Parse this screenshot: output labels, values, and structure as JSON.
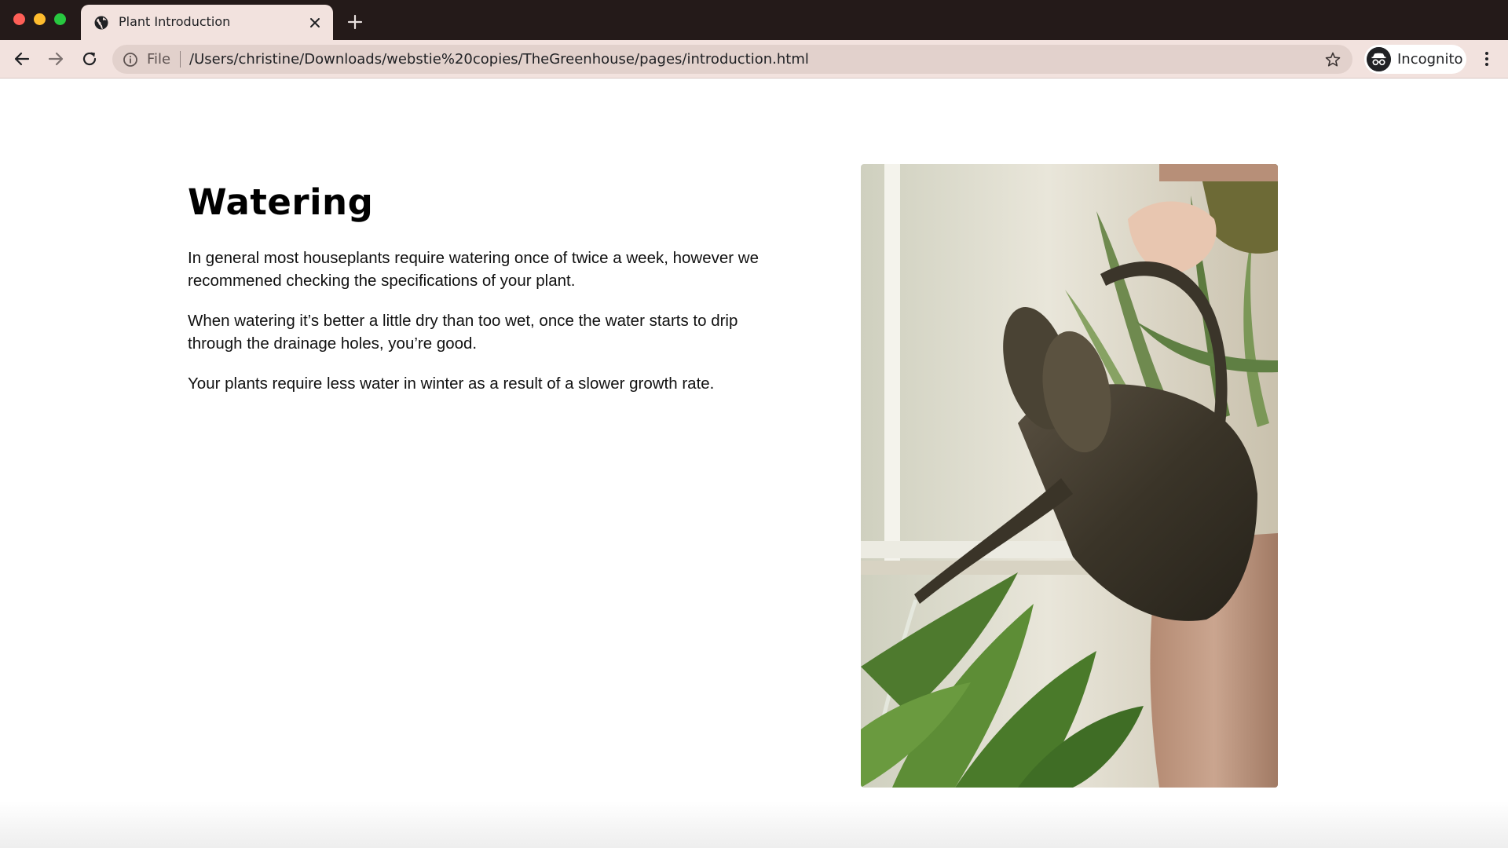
{
  "browser": {
    "tab": {
      "title": "Plant Introduction",
      "favicon": "globe-icon"
    },
    "address_bar": {
      "scheme_label": "File",
      "url": "/Users/christine/Downloads/webstie%20copies/TheGreenhouse/pages/introduction.html"
    },
    "profile": {
      "label": "Incognito",
      "icon": "incognito-icon"
    },
    "icons": {
      "back": "arrow-left-icon",
      "forward": "arrow-right-icon",
      "reload": "reload-icon",
      "info": "info-icon",
      "bookmark": "star-icon",
      "menu": "kebab-menu-icon",
      "new_tab": "plus-icon",
      "close_tab": "close-icon"
    },
    "colors": {
      "titlebar": "#241a19",
      "toolbar": "#f2e2de",
      "omnibox": "#e2d1cc"
    }
  },
  "content": {
    "heading": "Watering",
    "paragraphs": [
      "In general most houseplants require watering once of twice a week, however we recommened checking the specifications of your plant.",
      "When watering it’s better a little dry than too wet, once the water starts to drip through the drainage holes, you’re good.",
      "Your plants require less water in winter as a result of a slower growth rate."
    ]
  }
}
